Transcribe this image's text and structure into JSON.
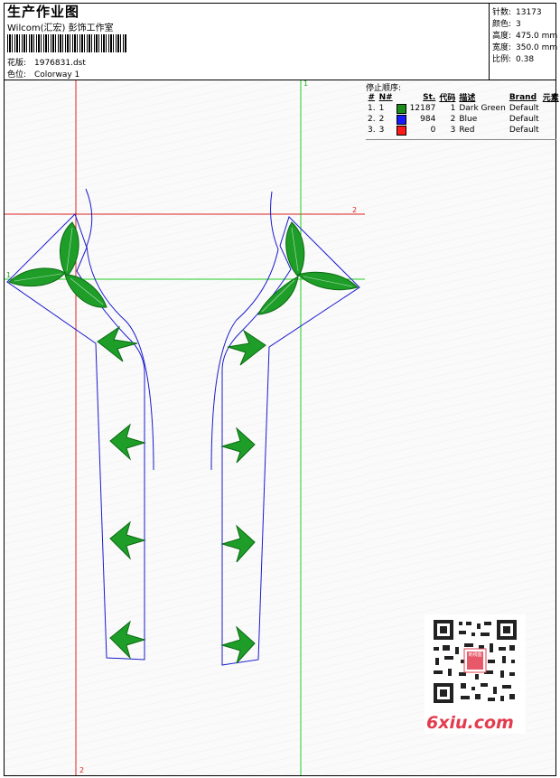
{
  "header": {
    "title": "生产作业图",
    "subtitle": "Wilcom(汇宏) 彭饰工作室",
    "design_label": "花版:",
    "design_value": "1976831.dst",
    "colorway_label": "色位:",
    "colorway_value": "Colorway 1"
  },
  "specs": [
    {
      "label": "针数:",
      "value": "13173"
    },
    {
      "label": "颜色:",
      "value": "3"
    },
    {
      "label": "高度:",
      "value": "475.0 mm"
    },
    {
      "label": "宽度:",
      "value": "350.0 mm"
    },
    {
      "label": "比例:",
      "value": "0.38"
    }
  ],
  "stop_sequence": {
    "title": "停止顺序:",
    "headers": [
      "#",
      "N#",
      "",
      "St.",
      "代码",
      "描述",
      "Brand",
      "元素"
    ],
    "rows": [
      {
        "idx": "1.",
        "n": "1",
        "color": "#1a8c1a",
        "st": "12187",
        "code": "1",
        "desc": "Dark Green",
        "brand": "Default"
      },
      {
        "idx": "2.",
        "n": "2",
        "color": "#1a1aff",
        "st": "984",
        "code": "2",
        "desc": "Blue",
        "brand": "Default"
      },
      {
        "idx": "3.",
        "n": "3",
        "color": "#ff1a1a",
        "st": "0",
        "code": "3",
        "desc": "Red",
        "brand": "Default"
      }
    ]
  },
  "guides": {
    "green_label": "1",
    "red_label": "2"
  },
  "watermark": {
    "text": "6xiu.com",
    "qr_label": "刺绣图"
  },
  "colors": {
    "leaf_fill": "#1e9e28",
    "leaf_stroke": "#0a6a12",
    "outline": "#1a1acc",
    "guide_red": "#dd2222",
    "guide_green": "#22cc22"
  }
}
